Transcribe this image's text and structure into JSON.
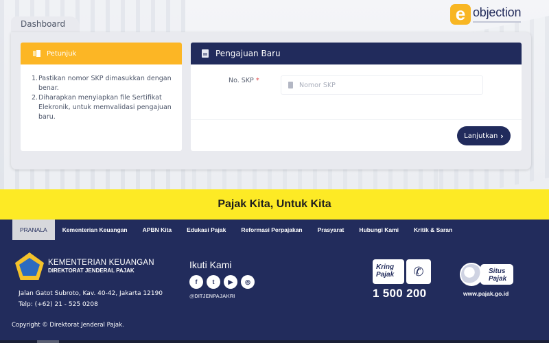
{
  "logo": {
    "badge_letter": "e",
    "word": "objection"
  },
  "dashboard": {
    "tab_label": "Dashboard"
  },
  "help_card": {
    "title": "Petunjuk",
    "items": [
      {
        "num": "1.",
        "text": "Pastikan nomor SKP dimasukkan dengan benar."
      },
      {
        "num": "2.",
        "text": "Diharapkan menyiapkan file Sertifikat Elekronik, untuk memvalidasi pengajuan baru."
      }
    ]
  },
  "form_card": {
    "title": "Pengajuan Baru",
    "skp_label": "No. SKP",
    "required_mark": "*",
    "skp_placeholder": "Nomor SKP",
    "skp_value": "",
    "submit_label": "Lanjutkan",
    "submit_icon": "›"
  },
  "banner": {
    "text": "Pajak Kita, Untuk Kita"
  },
  "footer": {
    "nav": [
      {
        "label": "PRANALA",
        "active": true
      },
      {
        "label": "Kementerian Keuangan"
      },
      {
        "label": "APBN Kita"
      },
      {
        "label": "Edukasi Pajak"
      },
      {
        "label": "Reformasi Perpajakan"
      },
      {
        "label": "Prasyarat"
      },
      {
        "label": "Hubungi Kami"
      },
      {
        "label": "Kritik & Saran"
      }
    ],
    "org": {
      "line1": "KEMENTERIAN KEUANGAN",
      "line2": "DIREKTORAT JENDERAL PAJAK",
      "address": "Jalan Gatot Subroto, Kav. 40-42, Jakarta 12190",
      "phone": "Telp: (+62) 21 - 525 0208"
    },
    "follow": {
      "title": "Ikuti Kami",
      "icons": [
        {
          "name": "facebook-icon",
          "glyph": "f"
        },
        {
          "name": "twitter-icon",
          "glyph": "t"
        },
        {
          "name": "youtube-icon",
          "glyph": "▶"
        },
        {
          "name": "instagram-icon",
          "glyph": "◎"
        }
      ],
      "handle": "@DITJENPAJAKRI"
    },
    "kring_pajak": {
      "label_line1": "Kring",
      "label_line2": "Pajak",
      "phone_icon": "✆",
      "number": "1 500 200"
    },
    "situs_pajak": {
      "label_line1": "Situs",
      "label_line2": "Pajak",
      "url": "www.pajak.go.id"
    },
    "copyright": "Copyright ©  Direktorat Jenderal Pajak."
  },
  "colors": {
    "navy": "#222c5c",
    "amber": "#fcb625",
    "yellow": "#fdea25"
  }
}
